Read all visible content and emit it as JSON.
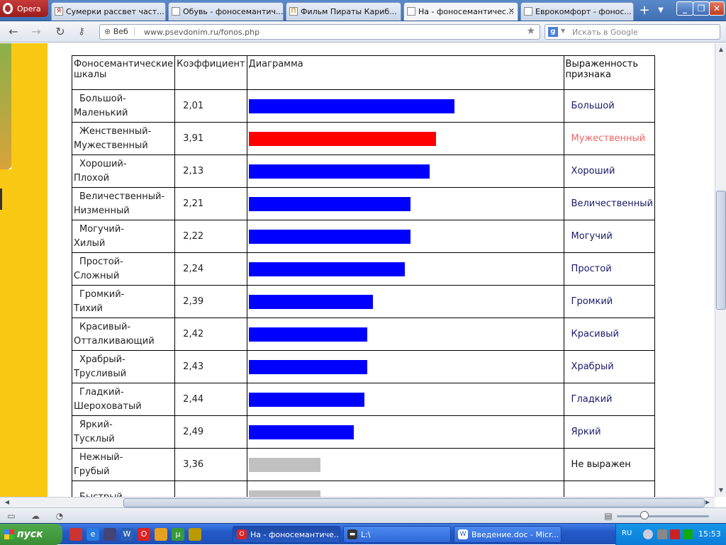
{
  "browser": {
    "menu_label": "Opera",
    "tabs": [
      {
        "title": "Сумерки рассвет част...",
        "fav": "Я"
      },
      {
        "title": "Обувь - фоносемантич...",
        "fav": ""
      },
      {
        "title": "Фильм Пираты Кариб...",
        "fav": "П"
      },
      {
        "title": "На - фоносемантичес...",
        "fav": ""
      },
      {
        "title": "Еврокомфорт - фонос...",
        "fav": ""
      }
    ],
    "active_tab": 3,
    "address": {
      "site_label": "Веб",
      "url": "www.psevdonim.ru/fonos.php"
    },
    "search": {
      "engine": "g",
      "placeholder": "Искать в Google"
    }
  },
  "table": {
    "headers": {
      "scale": "Фоносемантические шкалы",
      "coef": "Коэффициент",
      "diagram": "Диаграмма",
      "expr": "Выраженность признака"
    },
    "rows": [
      {
        "scale_a": "Большой-",
        "scale_b": "Маленький",
        "coef": "2,01",
        "expr": "Большой",
        "bar": 0.655,
        "color": "#0000ff",
        "expr_color": "#1a1a6a"
      },
      {
        "scale_a": "Женственный-",
        "scale_b": "Мужественный",
        "coef": "3,91",
        "expr": "Мужественный",
        "bar": 0.595,
        "color": "#ff0000",
        "expr_color": "#ee6666"
      },
      {
        "scale_a": "Хороший-",
        "scale_b": "Плохой",
        "coef": "2,13",
        "expr": "Хороший",
        "bar": 0.575,
        "color": "#0000ff",
        "expr_color": "#1a1a6a"
      },
      {
        "scale_a": "Величественный-",
        "scale_b": "Низменный",
        "coef": "2,21",
        "expr": "Величественный",
        "bar": 0.515,
        "color": "#0000ff",
        "expr_color": "#1a1a6a"
      },
      {
        "scale_a": "Могучий-",
        "scale_b": "Хилый",
        "coef": "2,22",
        "expr": "Могучий",
        "bar": 0.515,
        "color": "#0000ff",
        "expr_color": "#1a1a6a"
      },
      {
        "scale_a": "Простой-",
        "scale_b": "Сложный",
        "coef": "2,24",
        "expr": "Простой",
        "bar": 0.497,
        "color": "#0000ff",
        "expr_color": "#1a1a6a"
      },
      {
        "scale_a": "Громкий-",
        "scale_b": "Тихий",
        "coef": "2,39",
        "expr": "Громкий",
        "bar": 0.396,
        "color": "#0000ff",
        "expr_color": "#1a1a6a"
      },
      {
        "scale_a": "Красивый-",
        "scale_b": "Отталкивающий",
        "coef": "2,42",
        "expr": "Красивый",
        "bar": 0.376,
        "color": "#0000ff",
        "expr_color": "#1a1a6a"
      },
      {
        "scale_a": "Храбрый-",
        "scale_b": "Трусливый",
        "coef": "2,43",
        "expr": "Храбрый",
        "bar": 0.376,
        "color": "#0000ff",
        "expr_color": "#1a1a6a"
      },
      {
        "scale_a": "Гладкий-",
        "scale_b": "Шероховатый",
        "coef": "2,44",
        "expr": "Гладкий",
        "bar": 0.367,
        "color": "#0000ff",
        "expr_color": "#1a1a6a"
      },
      {
        "scale_a": "Яркий-",
        "scale_b": "Тусклый",
        "coef": "2,49",
        "expr": "Яркий",
        "bar": 0.335,
        "color": "#0000ff",
        "expr_color": "#1a1a6a"
      },
      {
        "scale_a": "Нежный-",
        "scale_b": "Грубый",
        "coef": "3,36",
        "expr": "Не выражен",
        "bar": 0.228,
        "color": "#c0c0c0",
        "expr_color": "#111111"
      },
      {
        "scale_a": "Быстрый-",
        "scale_b": "",
        "coef": "",
        "expr": "",
        "bar": 0.228,
        "color": "#c0c0c0",
        "expr_color": "#111111"
      }
    ]
  },
  "taskbar": {
    "start_label": "пуск",
    "tasks": [
      {
        "label": "На - фоносемантиче...",
        "icon": "opera-icon",
        "active": true
      },
      {
        "label": "L:\\",
        "icon": "folder-icon",
        "active": false
      },
      {
        "label": "Введение.doc - Micr...",
        "icon": "word-icon",
        "active": false
      }
    ],
    "lang": "RU",
    "clock": "15:53"
  }
}
